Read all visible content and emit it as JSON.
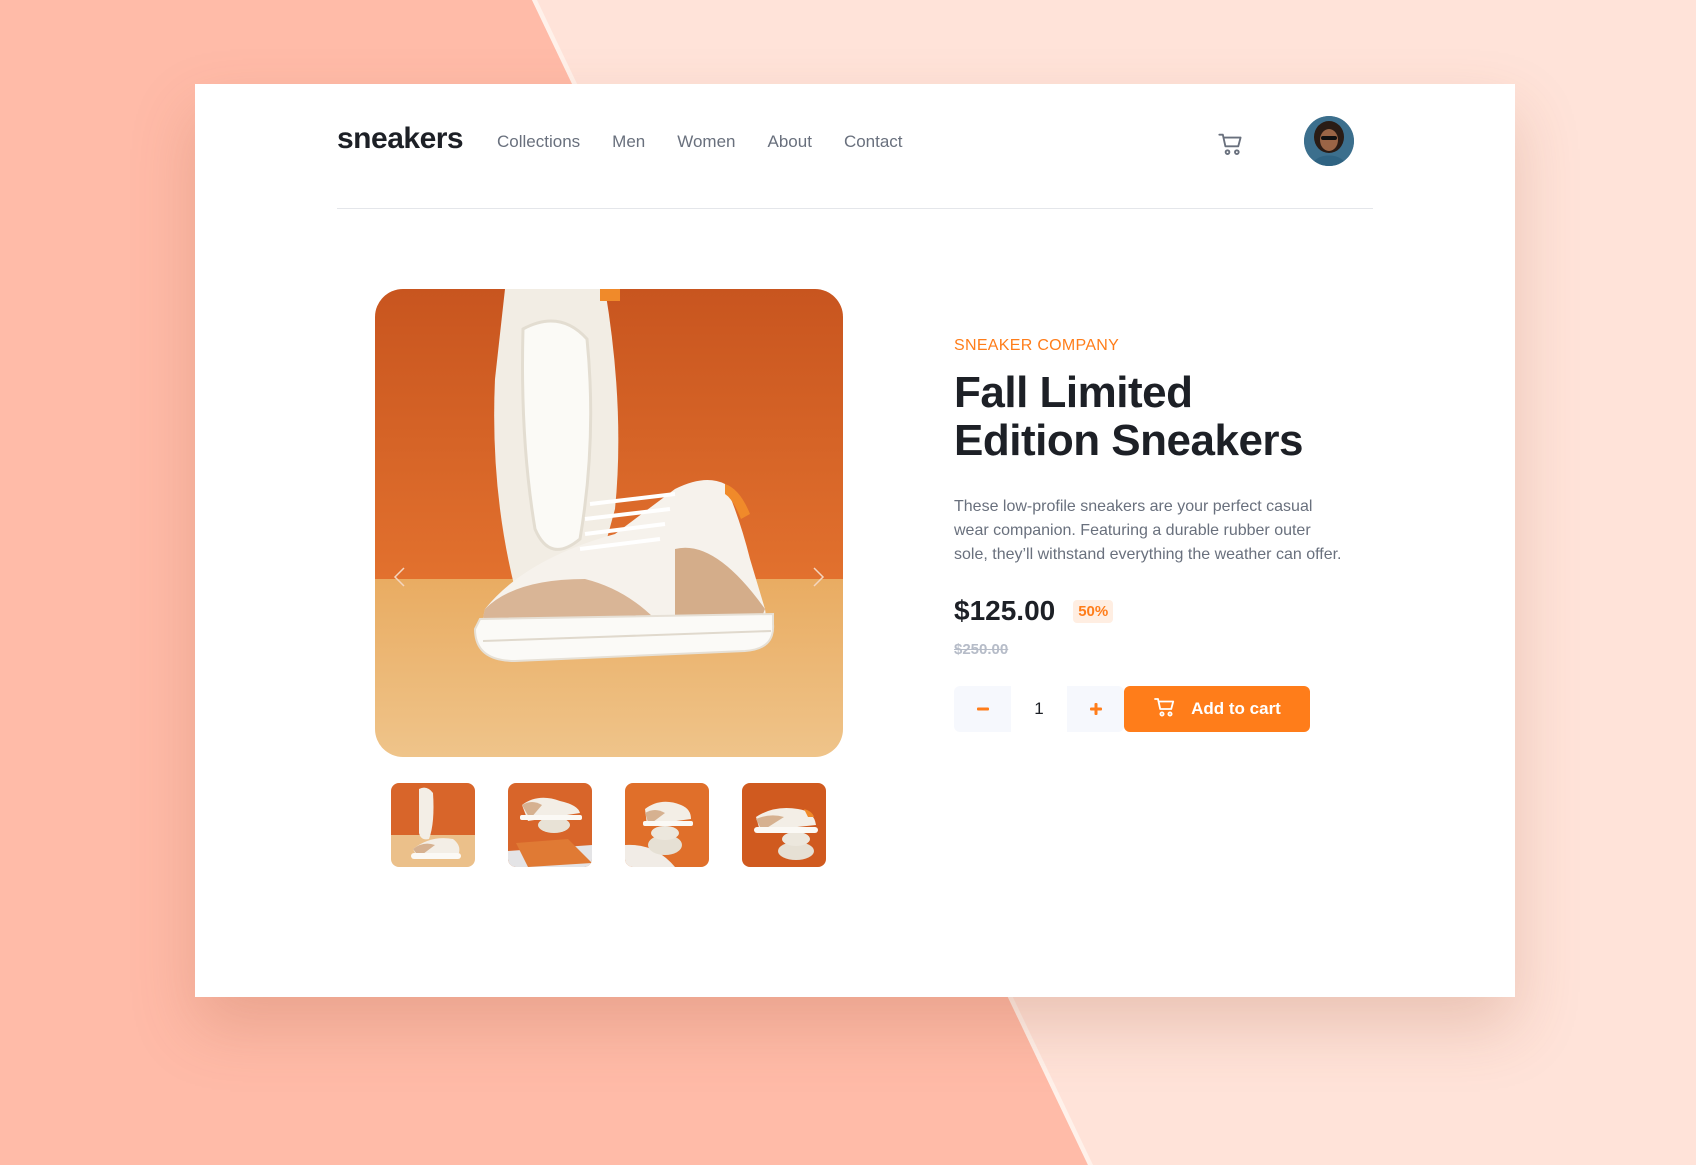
{
  "brand": {
    "logo": "sneakers"
  },
  "nav": {
    "items": [
      {
        "label": "Collections"
      },
      {
        "label": "Men"
      },
      {
        "label": "Women"
      },
      {
        "label": "About"
      },
      {
        "label": "Contact"
      }
    ],
    "cart_icon": "cart-icon",
    "avatar_icon": "user-avatar"
  },
  "product": {
    "company": "SNEAKER COMPANY",
    "title": "Fall Limited Edition Sneakers",
    "description": "These low-profile sneakers are your perfect casual wear companion. Featuring a durable rubber outer sole, they’ll withstand everything the weather can offer.",
    "price": "$125.00",
    "discount": "50%",
    "original_price": "$250.00",
    "quantity": "1",
    "add_to_cart_label": "Add to cart"
  },
  "gallery": {
    "prev_icon": "chevron-left-icon",
    "next_icon": "chevron-right-icon",
    "thumbnail_count": 4
  },
  "colors": {
    "accent": "#ff7d1a",
    "accent_pale": "#ffeee2",
    "dark": "#1d2026",
    "grey": "#69707d",
    "background": "#ffbba8"
  }
}
